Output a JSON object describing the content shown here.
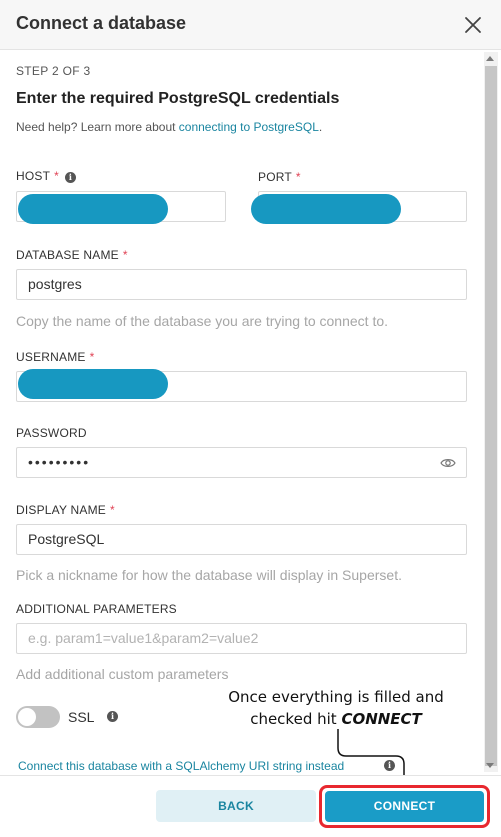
{
  "modal": {
    "title": "Connect a database",
    "close_icon": "close-icon"
  },
  "step": {
    "indicator": "STEP 2 OF 3",
    "heading": "Enter the required PostgreSQL credentials",
    "help_prefix": "Need help? Learn more about ",
    "help_link": "connecting to PostgreSQL",
    "help_suffix": "."
  },
  "fields": {
    "host": {
      "label": "HOST",
      "required": "*",
      "value": ""
    },
    "port": {
      "label": "PORT",
      "required": "*",
      "value": ""
    },
    "database_name": {
      "label": "DATABASE NAME",
      "required": "*",
      "value": "postgres",
      "hint": "Copy the name of the database you are trying to connect to."
    },
    "username": {
      "label": "USERNAME",
      "required": "*",
      "value": ""
    },
    "password": {
      "label": "PASSWORD",
      "value": "•••••••••"
    },
    "display_name": {
      "label": "DISPLAY NAME",
      "required": "*",
      "value": "PostgreSQL",
      "hint": "Pick a nickname for how the database will display in Superset."
    },
    "additional_parameters": {
      "label": "ADDITIONAL PARAMETERS",
      "placeholder": "e.g. param1=value1&param2=value2",
      "hint": "Add additional custom parameters"
    }
  },
  "ssl": {
    "label": "SSL",
    "enabled": false
  },
  "annotation": {
    "line1": "Once everything is filled and",
    "line2_prefix": "checked hit ",
    "line2_emphasis": "CONNECT"
  },
  "uri_link": "Connect this database with a SQLAlchemy URI string instead",
  "footer": {
    "back_label": "BACK",
    "connect_label": "CONNECT"
  },
  "colors": {
    "accent": "#1a9cc7",
    "required": "#e04355",
    "highlight": "#e8282f",
    "redaction": "#1798c1"
  }
}
